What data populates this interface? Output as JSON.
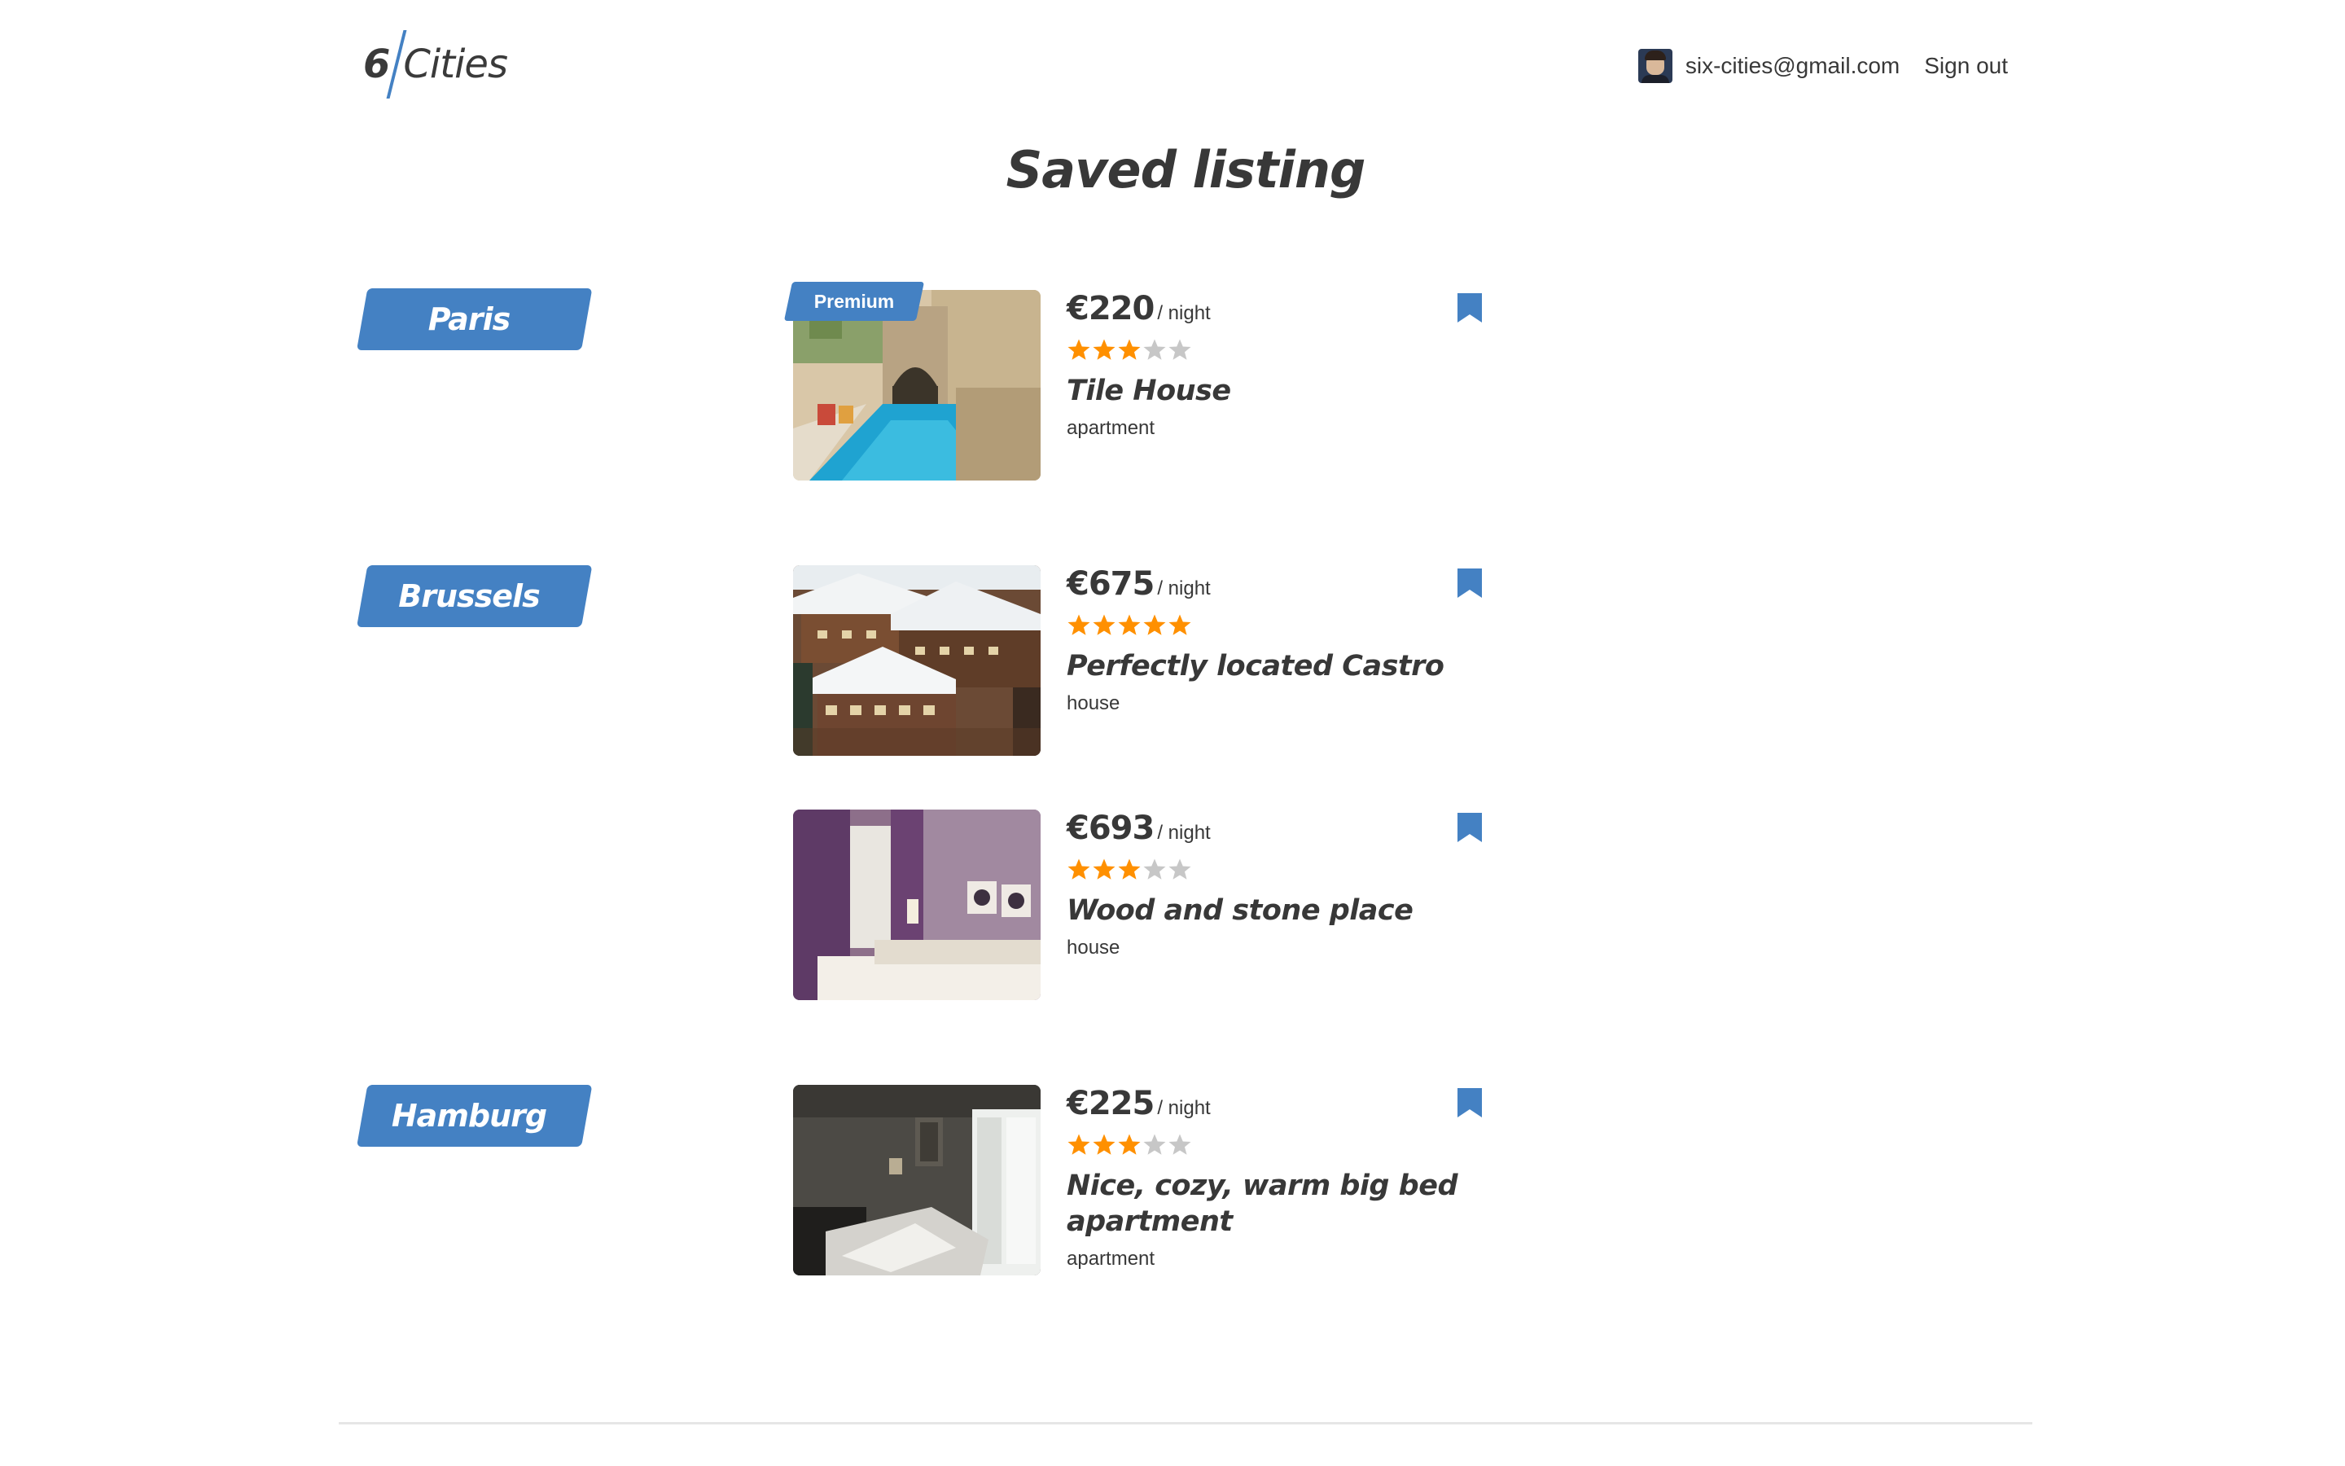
{
  "header": {
    "logo_number": "6",
    "logo_text": "Cities",
    "user_email": "six-cities@gmail.com",
    "sign_out_label": "Sign out"
  },
  "page_title": "Saved listing",
  "colors": {
    "accent": "#4481c3",
    "star_active": "#ff9000",
    "star_inactive": "#c7c7c7",
    "text": "#383838"
  },
  "cities": [
    {
      "name": "Paris",
      "offers": [
        {
          "premium": true,
          "premium_label": "Premium",
          "price": "€220",
          "per_night": "/ night",
          "rating": 3,
          "name": "Tile House",
          "type": "apartment",
          "image": "pool-courtyard"
        }
      ]
    },
    {
      "name": "Brussels",
      "offers": [
        {
          "premium": false,
          "price": "€675",
          "per_night": "/ night",
          "rating": 5,
          "name": "Perfectly located Castro",
          "type": "house",
          "image": "snowy-chalet"
        },
        {
          "premium": false,
          "price": "€693",
          "per_night": "/ night",
          "rating": 3,
          "name": "Wood and stone place",
          "type": "house",
          "image": "purple-bedroom"
        }
      ]
    },
    {
      "name": "Hamburg",
      "offers": [
        {
          "premium": false,
          "price": "€225",
          "per_night": "/ night",
          "rating": 3,
          "name": "Nice, cozy, warm big bed apartment",
          "type": "apartment",
          "image": "dark-bedroom"
        }
      ]
    }
  ]
}
